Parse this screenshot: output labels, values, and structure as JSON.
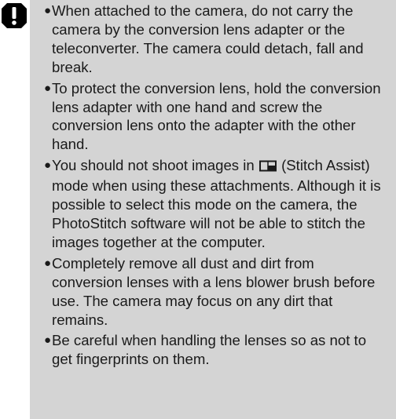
{
  "notes": {
    "bullet": "●",
    "items": [
      {
        "text": "When attached to the camera, do not carry the camera by the conversion lens adapter or the teleconverter. The camera could detach, fall and break."
      },
      {
        "text": "To protect the conversion lens, hold the conversion lens adapter with one hand and screw the conversion lens onto the adapter with the other hand."
      },
      {
        "text_before_icon": "You should not shoot images in ",
        "icon": "stitch-assist-icon",
        "text_after_icon": " (Stitch Assist) mode when using these attachments. Although it is possible to select this mode on the camera, the PhotoStitch software will not be able to stitch the images together at the computer."
      },
      {
        "text": "Completely remove all dust and dirt from conversion lenses with a lens blower brush before use. The camera may focus on any dirt that remains."
      },
      {
        "text": "Be careful when handling the lenses so as not to get fingerprints on them."
      }
    ]
  },
  "colors": {
    "panel_background": "#d4d4d4",
    "text": "#1a1a1a",
    "caution_icon": "#000000"
  },
  "icons": {
    "caution": "caution-icon",
    "stitch_assist": "stitch-assist-icon"
  }
}
